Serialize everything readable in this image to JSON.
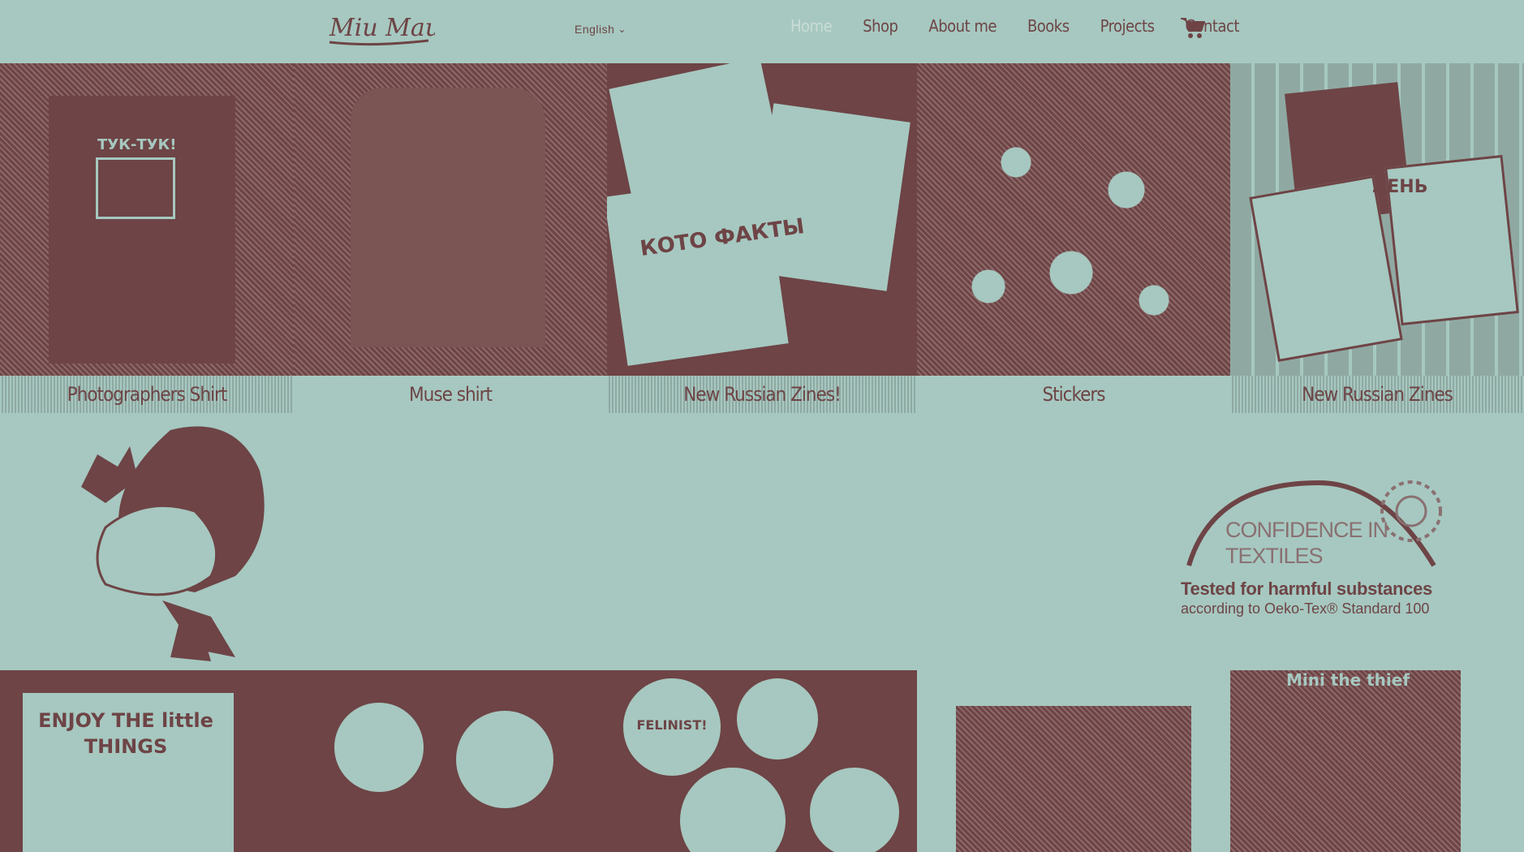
{
  "header": {
    "logo_text": "Miu Mau",
    "language": "English",
    "nav": [
      {
        "label": "Home",
        "active": true
      },
      {
        "label": "Shop",
        "active": false
      },
      {
        "label": "About me",
        "active": false
      },
      {
        "label": "Books",
        "active": false
      },
      {
        "label": "Projects",
        "active": false
      },
      {
        "label": "Contact",
        "active": false
      }
    ],
    "cart_icon": "shopping-cart-icon"
  },
  "top_tiles": [
    {
      "caption": "Photographers Shirt",
      "image_text": "ТУК-ТУК!"
    },
    {
      "caption": "Muse shirt"
    },
    {
      "caption": "New Russian Zines!",
      "image_text": "КОТО ФАКТЫ"
    },
    {
      "caption": "Stickers"
    },
    {
      "caption": "New Russian Zines",
      "image_text": "ЛЕНЬ"
    }
  ],
  "badge": {
    "title": "CONFIDENCE IN TEXTILES",
    "tested": "Tested for harmful substances",
    "standard": "according to Oeko-Tex® Standard 100"
  },
  "bottom_tiles": [
    {
      "image_text": "ENJOY THE little THINGS"
    },
    {
      "image_text": ""
    },
    {
      "image_text": "FELINIST!"
    },
    {
      "image_text": ""
    },
    {
      "image_text": "Mini the thief"
    }
  ],
  "colors": {
    "background": "#a6c8c0",
    "accent": "#6e4446"
  }
}
